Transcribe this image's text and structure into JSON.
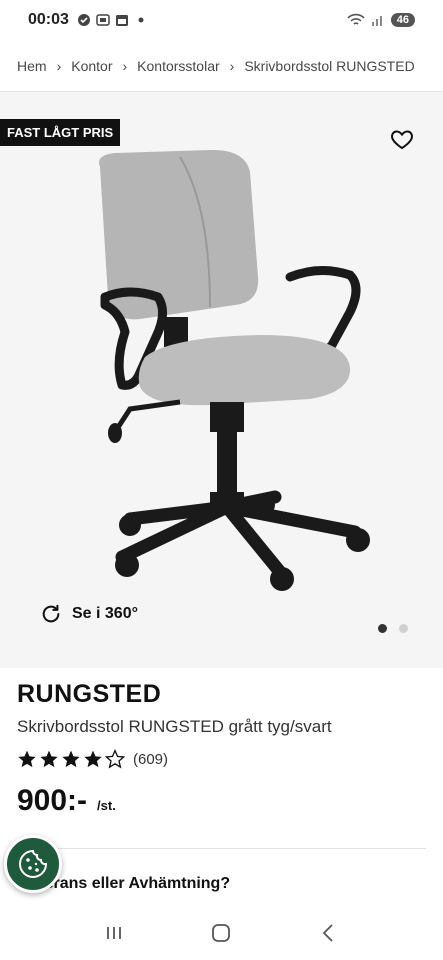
{
  "status_bar": {
    "time": "00:03",
    "battery": "46"
  },
  "breadcrumb": [
    "Hem",
    "Kontor",
    "Kontorsstolar",
    "Skrivbordsstol RUNGSTED"
  ],
  "badge": "FAST LÅGT PRIS",
  "rotate_label": "Se i 360°",
  "carousel": {
    "total": 2,
    "active_index": 0
  },
  "product": {
    "name": "RUNGSTED",
    "description": "Skrivbordsstol RUNGSTED grått tyg/svart",
    "rating": 4,
    "rating_max": 5,
    "review_count": "(609)",
    "price": "900:-",
    "price_unit": "/st."
  },
  "delivery_label": "Leverans eller Avhämtning?",
  "colors": {
    "cookie_button": "#1f5a3c",
    "badge_bg": "#111111",
    "hero_bg": "#f5f5f5"
  },
  "icons": [
    "wifi-icon",
    "signal-icon",
    "heart-icon",
    "rotate-icon",
    "star-icon",
    "cookie-icon",
    "recents-icon",
    "home-icon",
    "back-icon"
  ]
}
